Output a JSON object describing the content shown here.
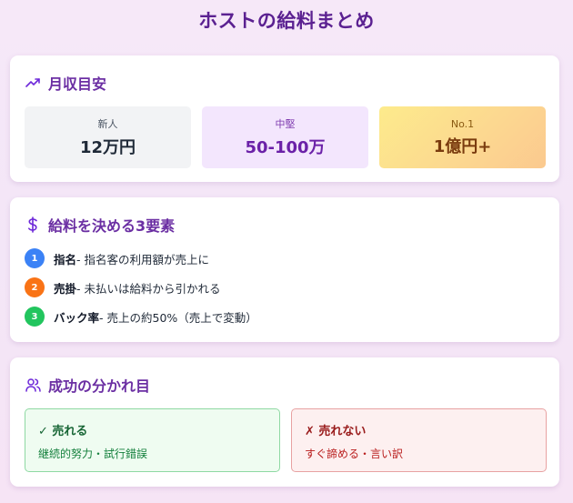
{
  "title": "ホストの給料まとめ",
  "income": {
    "heading": "月収目安",
    "icon": "trending-up-icon",
    "tiles": [
      {
        "label": "新人",
        "value": "12万円"
      },
      {
        "label": "中堅",
        "value": "50-100万"
      },
      {
        "label": "No.1",
        "value": "1億円+"
      }
    ]
  },
  "factors": {
    "heading": "給料を決める3要素",
    "icon": "dollar-icon",
    "items": [
      {
        "num": "1",
        "name": "指名",
        "desc": " - 指名客の利用額が売上に"
      },
      {
        "num": "2",
        "name": "売掛",
        "desc": " - 未払いは給料から引かれる"
      },
      {
        "num": "3",
        "name": "バック率",
        "desc": " - 売上の約50%（売上で変動）"
      }
    ]
  },
  "success": {
    "heading": "成功の分かれ目",
    "icon": "users-icon",
    "good": {
      "title": "✓ 売れる",
      "desc": "継続的努力・試行錯誤"
    },
    "bad": {
      "title": "✗ 売れない",
      "desc": "すぐ諦める・言い訳"
    }
  },
  "colors": {
    "accent": "#6b2fa3",
    "badge1": "#3b82f6",
    "badge2": "#f97316",
    "badge3": "#22c55e"
  }
}
